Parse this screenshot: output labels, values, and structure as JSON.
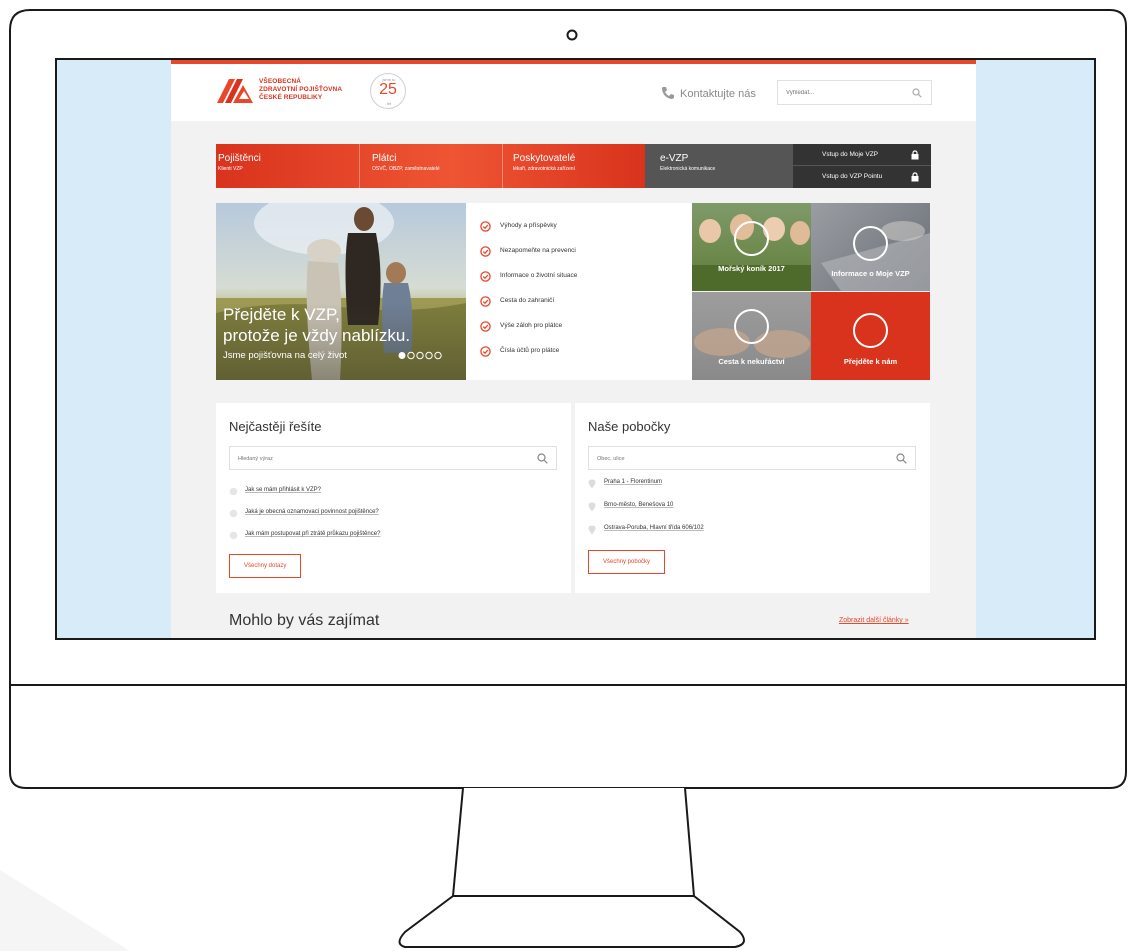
{
  "header": {
    "logo_lines": [
      "VŠEOBECNÁ",
      "ZDRAVOTNÍ POJIŠŤOVNA",
      "ČESKÉ REPUBLIKY"
    ],
    "anniversary": {
      "number": "25",
      "top_text": "jsme tu",
      "bottom_text": "let"
    },
    "contact_label": "Kontaktujte nás",
    "search_placeholder": "Vyhledat..."
  },
  "nav": {
    "items": [
      {
        "title": "Pojištěnci",
        "subtitle": "Klienti VZP"
      },
      {
        "title": "Plátci",
        "subtitle": "OSVČ, OBZP, zaměstnavatelé"
      },
      {
        "title": "Poskytovatelé",
        "subtitle": "lékaři, zdravotnická zařízení"
      },
      {
        "title": "e-VZP",
        "subtitle": "Elektronická komunikace"
      }
    ],
    "login": [
      "Vstup do Moje VZP",
      "Vstup do VZP Pointu"
    ]
  },
  "hero": {
    "headline_1": "Přejděte k VZP,",
    "headline_2": "protože je vždy nablízku.",
    "subline": "Jsme pojišťovna na celý život",
    "slides": 5,
    "active_slide": 1
  },
  "quick_links": [
    "Výhody a příspěvky",
    "Nezapomeňte na prevenci",
    "Informace o životní situace",
    "Cesta do zahraničí",
    "Výše záloh pro plátce",
    "Čísla účtů pro plátce"
  ],
  "tiles": [
    "Mořský koník 2017",
    "Informace o Moje VZP",
    "Cesta k nekuřáctví",
    "Přejděte k nám"
  ],
  "faq": {
    "title": "Nejčastěji řešíte",
    "placeholder": "Hledaný výraz",
    "questions": [
      "Jak se mám přihlásit k VZP?",
      "Jaká je obecná oznamovací povinnost pojištěnce?",
      "Jak mám postupovat při ztrátě průkazu pojištěnce?"
    ],
    "button": "Všechny dotazy"
  },
  "branches": {
    "title": "Naše pobočky",
    "placeholder": "Obec, ulice",
    "items": [
      "Praha 1 - Florentinum",
      "Brno-město, Benešova 10",
      "Ostrava-Poruba, Hlavní třída 606/102"
    ],
    "button": "Všechny pobočky"
  },
  "articles": {
    "title": "Mohlo by vás zajímat",
    "more_link": "Zobrazit další články »"
  },
  "colors": {
    "brand_red": "#e8472a",
    "dark_red": "#d9331d",
    "nav_gray": "#555555",
    "nav_dark": "#333333",
    "screen_bg": "#d7ebf9"
  }
}
